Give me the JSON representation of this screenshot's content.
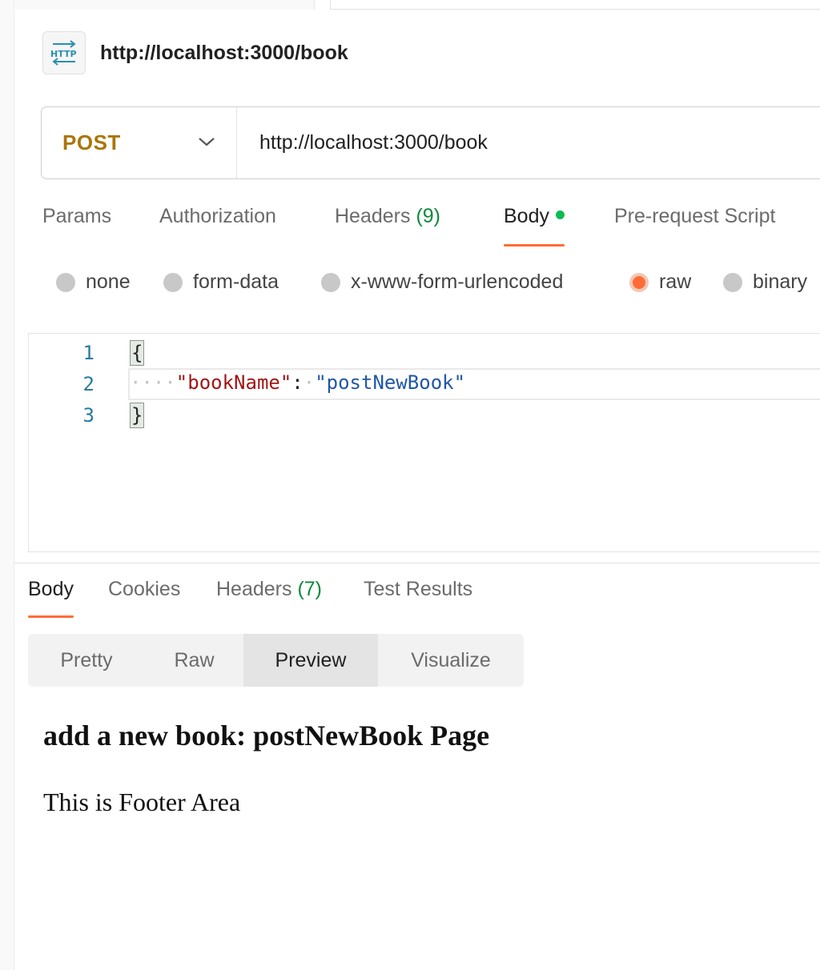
{
  "request": {
    "title": "http://localhost:3000/book",
    "icon": "http-icon",
    "method": "POST",
    "method_color": "#a9760b",
    "url": "http://localhost:3000/book"
  },
  "request_tabs": [
    {
      "label": "Params"
    },
    {
      "label": "Authorization"
    },
    {
      "label": "Headers",
      "count": "(9)"
    },
    {
      "label": "Body",
      "active": true,
      "indicator": "green-dot"
    },
    {
      "label": "Pre-request Script"
    }
  ],
  "body_types": [
    {
      "label": "none"
    },
    {
      "label": "form-data"
    },
    {
      "label": "x-www-form-urlencoded"
    },
    {
      "label": "raw",
      "checked": true
    },
    {
      "label": "binary"
    }
  ],
  "editor": {
    "line_numbers": [
      "1",
      "2",
      "3"
    ],
    "open_brace": "{",
    "indent": "····",
    "key": "\"bookName\"",
    "colon": ":",
    "space": "·",
    "value": "\"postNewBook\"",
    "close_brace": "}"
  },
  "response_tabs": [
    {
      "label": "Body",
      "active": true
    },
    {
      "label": "Cookies"
    },
    {
      "label": "Headers",
      "count": "(7)"
    },
    {
      "label": "Test Results"
    }
  ],
  "view_modes": [
    {
      "label": "Pretty"
    },
    {
      "label": "Raw"
    },
    {
      "label": "Preview",
      "active": true
    },
    {
      "label": "Visualize"
    }
  ],
  "preview": {
    "heading": "add a new book: postNewBook Page",
    "paragraph": "This is Footer Area"
  },
  "colors": {
    "accent": "#ff6c37",
    "count_green": "#0c8a3a",
    "dot_green": "#0cbb52"
  }
}
